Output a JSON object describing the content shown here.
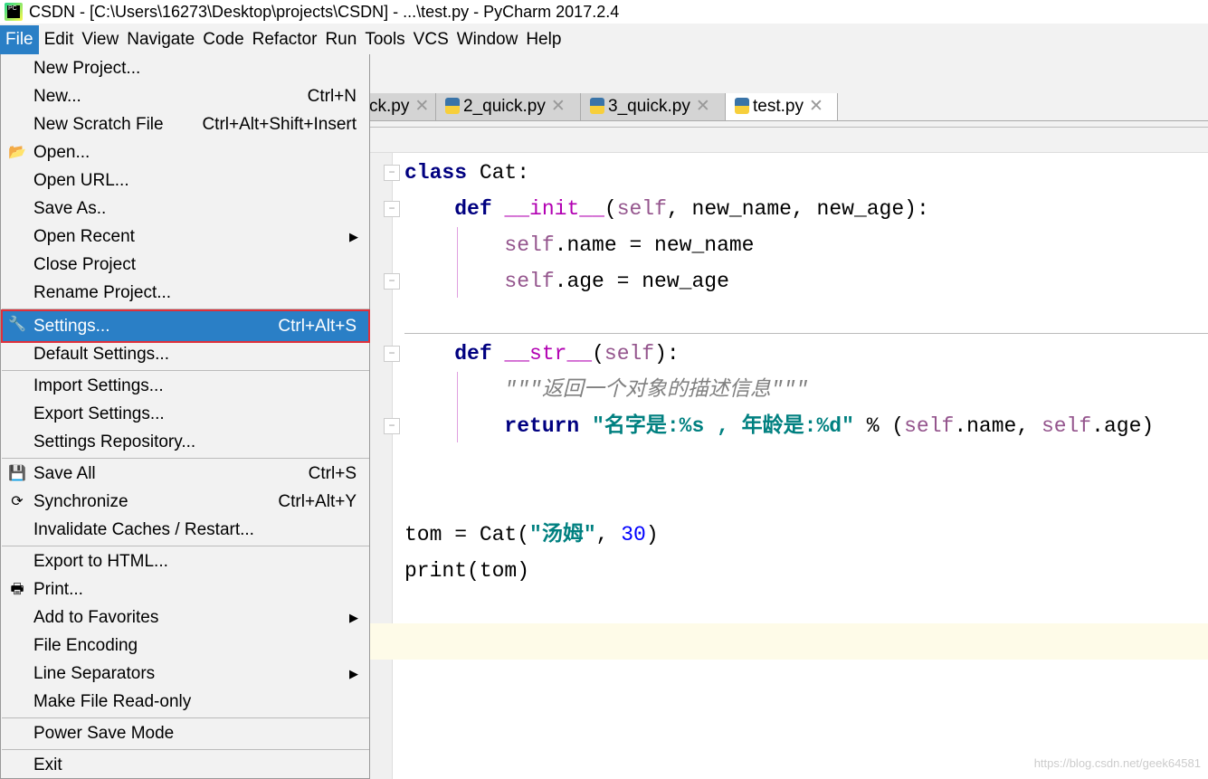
{
  "window": {
    "title": "CSDN - [C:\\Users\\16273\\Desktop\\projects\\CSDN] - ...\\test.py - PyCharm 2017.2.4",
    "logo": "PC"
  },
  "menubar": [
    "File",
    "Edit",
    "View",
    "Navigate",
    "Code",
    "Refactor",
    "Run",
    "Tools",
    "VCS",
    "Window",
    "Help"
  ],
  "tabs": [
    {
      "label": "ck.py",
      "selected": false
    },
    {
      "label": "2_quick.py",
      "selected": false
    },
    {
      "label": "3_quick.py",
      "selected": false
    },
    {
      "label": "test.py",
      "selected": true
    }
  ],
  "file_menu": {
    "items": [
      {
        "label": "New Project...",
        "shortcut": ""
      },
      {
        "label": "New...",
        "shortcut": "Ctrl+N"
      },
      {
        "label": "New Scratch File",
        "shortcut": "Ctrl+Alt+Shift+Insert"
      },
      {
        "label": "Open...",
        "shortcut": "",
        "icon": "folder-icon"
      },
      {
        "label": "Open URL...",
        "shortcut": ""
      },
      {
        "label": "Save As..",
        "shortcut": ""
      },
      {
        "label": "Open Recent",
        "shortcut": "",
        "submenu": true
      },
      {
        "label": "Close Project",
        "shortcut": ""
      },
      {
        "label": "Rename Project...",
        "shortcut": ""
      },
      {
        "label": "Settings...",
        "shortcut": "Ctrl+Alt+S",
        "icon": "wrench-icon",
        "highlighted": true
      },
      {
        "label": "Default Settings...",
        "shortcut": ""
      },
      {
        "label": "Import Settings...",
        "shortcut": ""
      },
      {
        "label": "Export Settings...",
        "shortcut": ""
      },
      {
        "label": "Settings Repository...",
        "shortcut": ""
      },
      {
        "label": "Save All",
        "shortcut": "Ctrl+S",
        "icon": "save-icon"
      },
      {
        "label": "Synchronize",
        "shortcut": "Ctrl+Alt+Y",
        "icon": "sync-icon"
      },
      {
        "label": "Invalidate Caches / Restart...",
        "shortcut": ""
      },
      {
        "label": "Export to HTML...",
        "shortcut": ""
      },
      {
        "label": "Print...",
        "shortcut": "",
        "icon": "printer-icon"
      },
      {
        "label": "Add to Favorites",
        "shortcut": "",
        "submenu": true
      },
      {
        "label": "File Encoding",
        "shortcut": ""
      },
      {
        "label": "Line Separators",
        "shortcut": "",
        "submenu": true
      },
      {
        "label": "Make File Read-only",
        "shortcut": ""
      },
      {
        "label": "Power Save Mode",
        "shortcut": ""
      },
      {
        "label": "Exit",
        "shortcut": ""
      }
    ]
  },
  "code": {
    "l1": [
      "class",
      " Cat:"
    ],
    "l2": [
      "def",
      " ",
      "__init__",
      "(",
      "self",
      ", new_name, new_age):"
    ],
    "l3": [
      "self",
      ".name = new_name"
    ],
    "l4": [
      "self",
      ".age = new_age"
    ],
    "l5": [
      "def",
      " ",
      "__str__",
      "(",
      "self",
      "):"
    ],
    "l6": "\"\"\"返回一个对象的描述信息\"\"\"",
    "l7": [
      "return",
      " ",
      "\"名字是:%s , 年龄是:%d\"",
      " % (",
      "self",
      ".name, ",
      "self",
      ".age)"
    ],
    "l8": [
      "tom = Cat(",
      "\"汤姆\"",
      ", ",
      "30",
      ")"
    ],
    "l9": "print(tom)"
  },
  "watermark": "https://blog.csdn.net/geek64581"
}
